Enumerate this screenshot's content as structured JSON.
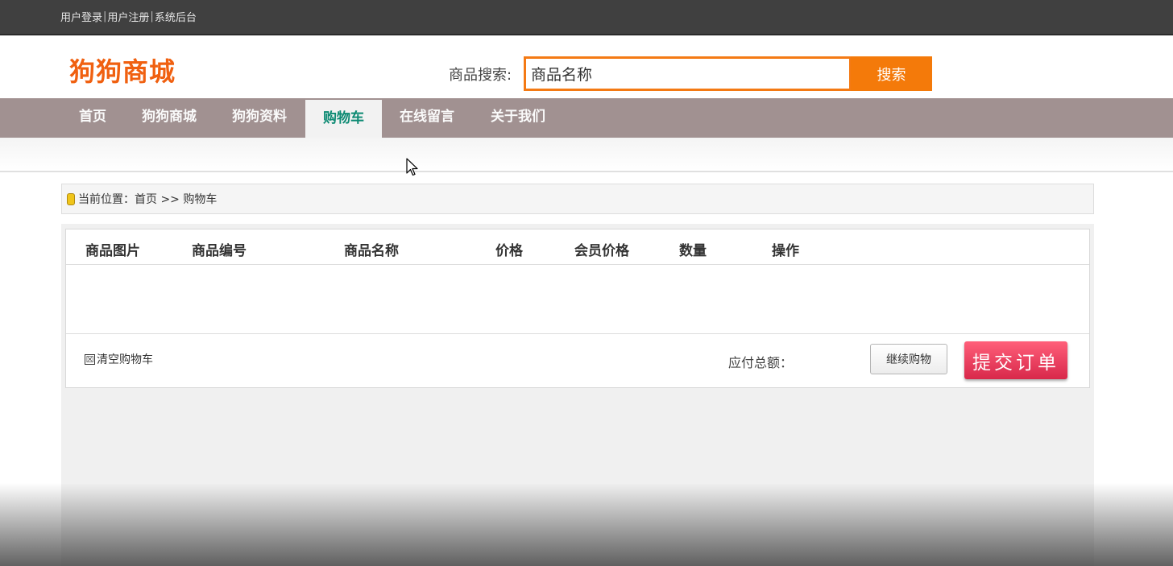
{
  "topbar": {
    "links": [
      "用户登录",
      "用户注册",
      "系统后台"
    ],
    "separator": "|"
  },
  "header": {
    "logo": "狗狗商城",
    "search": {
      "label": "商品搜索:",
      "value": "商品名称",
      "button": "搜索"
    }
  },
  "nav": {
    "items": [
      {
        "label": "首页",
        "active": false
      },
      {
        "label": "狗狗商城",
        "active": false
      },
      {
        "label": "狗狗资料",
        "active": false
      },
      {
        "label": "购物车",
        "active": true
      },
      {
        "label": "在线留言",
        "active": false
      },
      {
        "label": "关于我们",
        "active": false
      }
    ]
  },
  "breadcrumb": {
    "text": "当前位置：首页 >> 购物车"
  },
  "cart": {
    "columns": [
      "商品图片",
      "商品编号",
      "商品名称",
      "价格",
      "会员价格",
      "数量",
      "操作"
    ],
    "rows": [],
    "clear_checkbox": "☒",
    "clear_label": "清空购物车",
    "total_label": "应付总额：",
    "continue_button": "继续购物",
    "submit_button": "提交订单"
  },
  "colors": {
    "accent_orange": "#f47a0a",
    "nav_bg": "#a19191",
    "active_tab_text": "#0c8a73",
    "submit_red": "#e0304f",
    "topbar_bg": "#404040"
  }
}
